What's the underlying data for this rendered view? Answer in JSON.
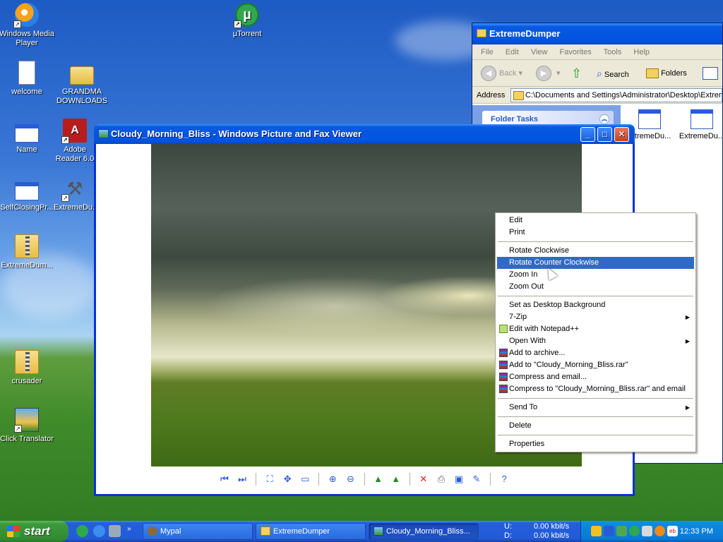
{
  "desktop": {
    "icons": [
      {
        "label": "Windows Media Player"
      },
      {
        "label": "µTorrent"
      },
      {
        "label": "welcome"
      },
      {
        "label": "GRANDMA DOWNLOADS"
      },
      {
        "label": "Name"
      },
      {
        "label": "Adobe Reader 6.0"
      },
      {
        "label": "SelfClosingPr..."
      },
      {
        "label": "ExtremeDu..."
      },
      {
        "label": "ExtremeDum..."
      },
      {
        "label": "crusader"
      },
      {
        "label": "Click Translator"
      }
    ]
  },
  "explorer": {
    "title": "ExtremeDumper",
    "menu": [
      "File",
      "Edit",
      "View",
      "Favorites",
      "Tools",
      "Help"
    ],
    "toolbar": {
      "back": "Back",
      "search": "Search",
      "folders": "Folders"
    },
    "address_label": "Address",
    "address_value": "C:\\Documents and Settings\\Administrator\\Desktop\\ExtremeDumper",
    "folder_tasks": "Folder Tasks",
    "files": [
      "...tremeDu...",
      "ExtremeDu..."
    ]
  },
  "viewer": {
    "title": "Cloudy_Morning_Bliss - Windows Picture and Fax Viewer",
    "toolbar_icons": [
      "previous-icon",
      "next-icon",
      "best-fit-icon",
      "actual-size-icon",
      "slideshow-icon",
      "zoom-in-icon",
      "zoom-out-icon",
      "rotate-clockwise-icon",
      "rotate-counterclockwise-icon",
      "delete-icon",
      "print-icon",
      "save-icon",
      "edit-icon",
      "help-icon"
    ]
  },
  "context_menu": {
    "groups": [
      [
        "Edit",
        "Print"
      ],
      [
        "Rotate Clockwise",
        "Rotate Counter Clockwise",
        "Zoom In",
        "Zoom Out"
      ],
      [
        "Set as Desktop Background",
        "7-Zip",
        "Edit with Notepad++",
        "Open With",
        "Add to archive...",
        "Add to \"Cloudy_Morning_Bliss.rar\"",
        "Compress and email...",
        "Compress to \"Cloudy_Morning_Bliss.rar\" and email"
      ],
      [
        "Send To"
      ],
      [
        "Delete"
      ],
      [
        "Properties"
      ]
    ],
    "highlighted": "Rotate Counter Clockwise"
  },
  "taskbar": {
    "start": "start",
    "tasks": [
      "Mypal",
      "ExtremeDumper",
      "Cloudy_Morning_Bliss..."
    ],
    "net_up_label": "U:",
    "net_up_value": "0.00 kbit/s",
    "net_down_label": "D:",
    "net_down_value": "0.00 kbit/s",
    "clock": "12:33 PM"
  },
  "colors": {
    "title_bar": "#0053e1",
    "menu_highlight": "#316ac5",
    "start_button": "#3c9a3c"
  }
}
